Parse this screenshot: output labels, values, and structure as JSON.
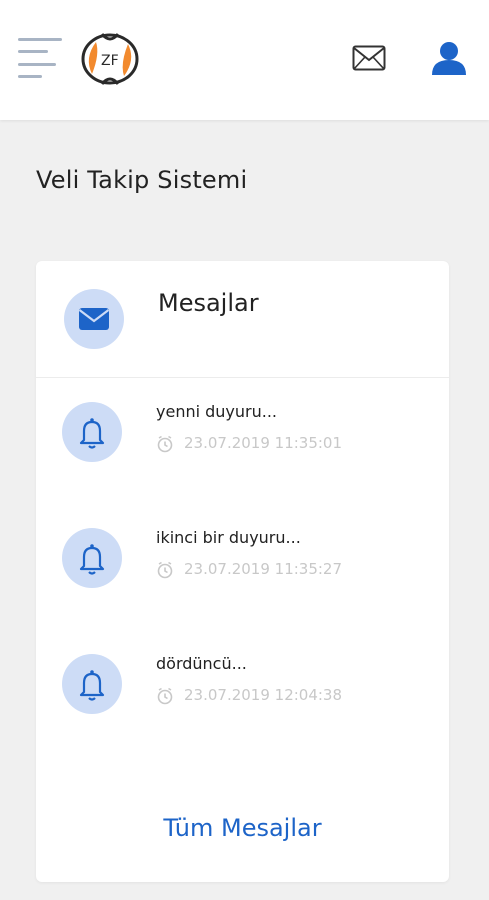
{
  "header": {
    "menu_icon": "hamburger-menu-icon",
    "logo_icon": "school-logo",
    "mail_icon": "envelope-icon",
    "user_icon": "user-icon"
  },
  "page": {
    "title": "Veli Takip Sistemi"
  },
  "card": {
    "title": "Mesajlar",
    "icon": "envelope-icon",
    "messages": [
      {
        "title": "yenni duyuru...",
        "time": "23.07.2019 11:35:01",
        "icon": "bell-icon"
      },
      {
        "title": "ikinci bir duyuru...",
        "time": "23.07.2019 11:35:27",
        "icon": "bell-icon"
      },
      {
        "title": "dördüncü...",
        "time": "23.07.2019 12:04:38",
        "icon": "bell-icon"
      }
    ],
    "all_link": "Tüm Mesajlar"
  },
  "colors": {
    "accent": "#1d64c8",
    "icon_circle": "#cddcf6",
    "timestamp": "#c8c8c8"
  }
}
